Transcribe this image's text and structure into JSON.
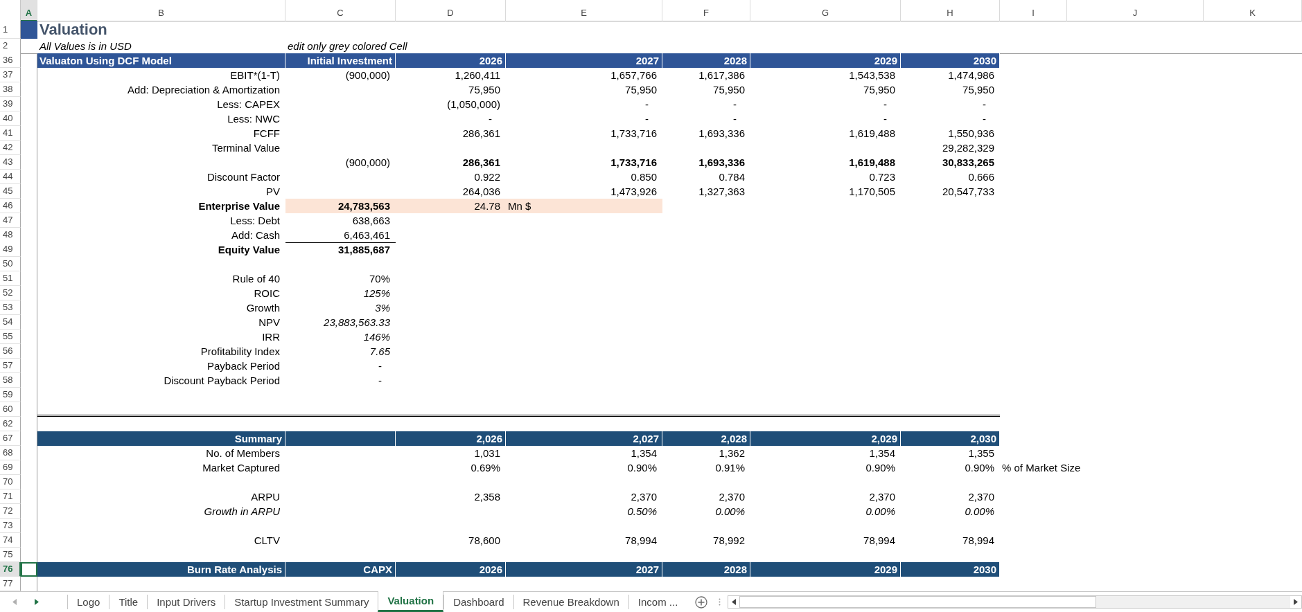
{
  "columns": [
    {
      "label": "A",
      "selected": true
    },
    {
      "label": "B",
      "selected": false
    },
    {
      "label": "C",
      "selected": false
    },
    {
      "label": "D",
      "selected": false
    },
    {
      "label": "E",
      "selected": false
    },
    {
      "label": "F",
      "selected": false
    },
    {
      "label": "G",
      "selected": false
    },
    {
      "label": "H",
      "selected": false
    },
    {
      "label": "I",
      "selected": false
    },
    {
      "label": "J",
      "selected": false
    },
    {
      "label": "K",
      "selected": false
    }
  ],
  "rows": [
    {
      "number": "1",
      "kind": "title",
      "selected": false,
      "cells": [
        {
          "kind": "fill"
        },
        {
          "kind": "title",
          "text": "Valuation"
        }
      ]
    },
    {
      "number": "2",
      "kind": "data",
      "selected": false,
      "cells": [
        {
          "kind": "empty"
        },
        {
          "kind": "note",
          "text": "All Values is in USD"
        },
        {
          "kind": "note",
          "text": "edit only grey colored Cell"
        }
      ]
    },
    {
      "number": "36",
      "kind": "band",
      "color": "#2f5597",
      "selected": false,
      "cells": [
        {
          "kind": "empty"
        },
        {
          "kind": "band-left",
          "text": "Valuaton Using DCF Model"
        },
        {
          "kind": "bold",
          "text": "Initial Investment"
        },
        {
          "kind": "bold",
          "text": "2026"
        },
        {
          "kind": "bold",
          "text": "2027"
        },
        {
          "kind": "bold",
          "text": "2028"
        },
        {
          "kind": "bold",
          "text": "2029"
        },
        {
          "kind": "bold",
          "text": "2030"
        }
      ]
    },
    {
      "number": "37",
      "kind": "data",
      "selected": false,
      "cells": [
        {
          "kind": "empty"
        },
        {
          "kind": "plain",
          "text": "EBIT*(1-T)"
        },
        {
          "kind": "plain",
          "text": "(900,000)"
        },
        {
          "kind": "plain",
          "text": "1,260,411"
        },
        {
          "kind": "plain",
          "text": "1,657,766"
        },
        {
          "kind": "plain",
          "text": "1,617,386"
        },
        {
          "kind": "plain",
          "text": "1,543,538"
        },
        {
          "kind": "plain",
          "text": "1,474,986"
        }
      ]
    },
    {
      "number": "38",
      "kind": "data",
      "selected": false,
      "cells": [
        {
          "kind": "empty"
        },
        {
          "kind": "plain",
          "text": "Add: Depreciation & Amortization"
        },
        {
          "kind": "empty"
        },
        {
          "kind": "plain",
          "text": "75,950"
        },
        {
          "kind": "plain",
          "text": "75,950"
        },
        {
          "kind": "plain",
          "text": "75,950"
        },
        {
          "kind": "plain",
          "text": "75,950"
        },
        {
          "kind": "plain",
          "text": "75,950"
        }
      ]
    },
    {
      "number": "39",
      "kind": "data",
      "selected": false,
      "cells": [
        {
          "kind": "empty"
        },
        {
          "kind": "plain",
          "text": "Less: CAPEX"
        },
        {
          "kind": "empty"
        },
        {
          "kind": "plain",
          "text": "(1,050,000)"
        },
        {
          "kind": "dash",
          "text": "-"
        },
        {
          "kind": "dash",
          "text": "-"
        },
        {
          "kind": "dash",
          "text": "-"
        },
        {
          "kind": "dash",
          "text": "-"
        }
      ]
    },
    {
      "number": "40",
      "kind": "data",
      "selected": false,
      "cells": [
        {
          "kind": "empty"
        },
        {
          "kind": "plain",
          "text": "Less: NWC"
        },
        {
          "kind": "empty"
        },
        {
          "kind": "dash",
          "text": "-"
        },
        {
          "kind": "dash",
          "text": "-"
        },
        {
          "kind": "dash",
          "text": "-"
        },
        {
          "kind": "dash",
          "text": "-"
        },
        {
          "kind": "dash",
          "text": "-"
        }
      ]
    },
    {
      "number": "41",
      "kind": "data",
      "selected": false,
      "cells": [
        {
          "kind": "empty"
        },
        {
          "kind": "plain",
          "text": "FCFF"
        },
        {
          "kind": "empty"
        },
        {
          "kind": "plain",
          "text": "286,361"
        },
        {
          "kind": "plain",
          "text": "1,733,716"
        },
        {
          "kind": "plain",
          "text": "1,693,336"
        },
        {
          "kind": "plain",
          "text": "1,619,488"
        },
        {
          "kind": "plain",
          "text": "1,550,936"
        }
      ]
    },
    {
      "number": "42",
      "kind": "data",
      "selected": false,
      "cells": [
        {
          "kind": "empty"
        },
        {
          "kind": "plain",
          "text": "Terminal Value"
        },
        {
          "kind": "empty"
        },
        {
          "kind": "empty"
        },
        {
          "kind": "empty"
        },
        {
          "kind": "empty"
        },
        {
          "kind": "empty"
        },
        {
          "kind": "plain",
          "text": "29,282,329"
        }
      ]
    },
    {
      "number": "43",
      "kind": "data",
      "selected": false,
      "cells": [
        {
          "kind": "empty"
        },
        {
          "kind": "empty"
        },
        {
          "kind": "plain",
          "text": "(900,000)"
        },
        {
          "kind": "bold",
          "text": "286,361"
        },
        {
          "kind": "bold",
          "text": "1,733,716"
        },
        {
          "kind": "bold",
          "text": "1,693,336"
        },
        {
          "kind": "bold",
          "text": "1,619,488"
        },
        {
          "kind": "bold",
          "text": "30,833,265"
        }
      ]
    },
    {
      "number": "44",
      "kind": "data",
      "selected": false,
      "cells": [
        {
          "kind": "empty"
        },
        {
          "kind": "plain",
          "text": "Discount Factor"
        },
        {
          "kind": "empty"
        },
        {
          "kind": "plain",
          "text": "0.922"
        },
        {
          "kind": "plain",
          "text": "0.850"
        },
        {
          "kind": "plain",
          "text": "0.784"
        },
        {
          "kind": "plain",
          "text": "0.723"
        },
        {
          "kind": "plain",
          "text": "0.666"
        }
      ]
    },
    {
      "number": "45",
      "kind": "data",
      "selected": false,
      "cells": [
        {
          "kind": "empty"
        },
        {
          "kind": "plain",
          "text": "PV"
        },
        {
          "kind": "empty"
        },
        {
          "kind": "plain",
          "text": "264,036"
        },
        {
          "kind": "plain",
          "text": "1,473,926"
        },
        {
          "kind": "plain",
          "text": "1,327,363"
        },
        {
          "kind": "plain",
          "text": "1,170,505"
        },
        {
          "kind": "plain",
          "text": "20,547,733"
        }
      ]
    },
    {
      "number": "46",
      "kind": "data",
      "selected": false,
      "cells": [
        {
          "kind": "empty"
        },
        {
          "kind": "bold",
          "text": "Enterprise Value"
        },
        {
          "kind": "shaded-bold",
          "text": "24,783,563"
        },
        {
          "kind": "shaded",
          "text": "24.78"
        },
        {
          "kind": "shaded-unit",
          "text": "Mn $"
        }
      ]
    },
    {
      "number": "47",
      "kind": "data",
      "selected": false,
      "cells": [
        {
          "kind": "empty"
        },
        {
          "kind": "plain",
          "text": "Less: Debt"
        },
        {
          "kind": "plain",
          "text": "638,663"
        }
      ]
    },
    {
      "number": "48",
      "kind": "data",
      "selected": false,
      "cells": [
        {
          "kind": "empty"
        },
        {
          "kind": "plain",
          "text": "Add: Cash"
        },
        {
          "kind": "ruled",
          "text": "6,463,461"
        }
      ]
    },
    {
      "number": "49",
      "kind": "data",
      "selected": false,
      "cells": [
        {
          "kind": "empty"
        },
        {
          "kind": "bold",
          "text": "Equity Value"
        },
        {
          "kind": "bold",
          "text": "31,885,687"
        }
      ]
    },
    {
      "number": "50",
      "kind": "data",
      "selected": false,
      "cells": []
    },
    {
      "number": "51",
      "kind": "data",
      "selected": false,
      "cells": [
        {
          "kind": "empty"
        },
        {
          "kind": "plain",
          "text": "Rule of 40"
        },
        {
          "kind": "plain",
          "text": "70%"
        }
      ]
    },
    {
      "number": "52",
      "kind": "data",
      "selected": false,
      "cells": [
        {
          "kind": "empty"
        },
        {
          "kind": "plain",
          "text": "ROIC"
        },
        {
          "kind": "italic",
          "text": "125%"
        }
      ]
    },
    {
      "number": "53",
      "kind": "data",
      "selected": false,
      "cells": [
        {
          "kind": "empty"
        },
        {
          "kind": "plain",
          "text": "Growth"
        },
        {
          "kind": "italic",
          "text": "3%"
        }
      ]
    },
    {
      "number": "54",
      "kind": "data",
      "selected": false,
      "cells": [
        {
          "kind": "empty"
        },
        {
          "kind": "plain",
          "text": "NPV"
        },
        {
          "kind": "italic",
          "text": "23,883,563.33"
        }
      ]
    },
    {
      "number": "55",
      "kind": "data",
      "selected": false,
      "cells": [
        {
          "kind": "empty"
        },
        {
          "kind": "plain",
          "text": "IRR"
        },
        {
          "kind": "italic",
          "text": "146%"
        }
      ]
    },
    {
      "number": "56",
      "kind": "data",
      "selected": false,
      "cells": [
        {
          "kind": "empty"
        },
        {
          "kind": "plain",
          "text": "Profitability Index"
        },
        {
          "kind": "italic",
          "text": "7.65"
        }
      ]
    },
    {
      "number": "57",
      "kind": "data",
      "selected": false,
      "cells": [
        {
          "kind": "empty"
        },
        {
          "kind": "plain",
          "text": "Payback Period"
        },
        {
          "kind": "dash",
          "text": "-"
        }
      ]
    },
    {
      "number": "58",
      "kind": "data",
      "selected": false,
      "cells": [
        {
          "kind": "empty"
        },
        {
          "kind": "plain",
          "text": "Discount Payback Period"
        },
        {
          "kind": "dash",
          "text": "-"
        }
      ]
    },
    {
      "number": "59",
      "kind": "data",
      "selected": false,
      "cells": []
    },
    {
      "number": "60",
      "kind": "rule",
      "selected": false,
      "cells": []
    },
    {
      "number": "62",
      "kind": "data",
      "selected": false,
      "cells": []
    },
    {
      "number": "67",
      "kind": "band",
      "color": "#1f4e78",
      "selected": false,
      "cells": [
        {
          "kind": "empty"
        },
        {
          "kind": "bold",
          "text": "Summary"
        },
        {
          "kind": "empty"
        },
        {
          "kind": "bold",
          "text": "2,026"
        },
        {
          "kind": "bold",
          "text": "2,027"
        },
        {
          "kind": "bold",
          "text": "2,028"
        },
        {
          "kind": "bold",
          "text": "2,029"
        },
        {
          "kind": "bold",
          "text": "2,030"
        }
      ]
    },
    {
      "number": "68",
      "kind": "data",
      "selected": false,
      "cells": [
        {
          "kind": "empty"
        },
        {
          "kind": "plain",
          "text": "No. of Members"
        },
        {
          "kind": "empty"
        },
        {
          "kind": "plain",
          "text": "1,031"
        },
        {
          "kind": "plain",
          "text": "1,354"
        },
        {
          "kind": "plain",
          "text": "1,362"
        },
        {
          "kind": "plain",
          "text": "1,354"
        },
        {
          "kind": "plain",
          "text": "1,355"
        }
      ]
    },
    {
      "number": "69",
      "kind": "data",
      "selected": false,
      "cells": [
        {
          "kind": "empty"
        },
        {
          "kind": "plain",
          "text": "Market Captured"
        },
        {
          "kind": "empty"
        },
        {
          "kind": "plain",
          "text": "0.69%"
        },
        {
          "kind": "plain",
          "text": "0.90%"
        },
        {
          "kind": "plain",
          "text": "0.91%"
        },
        {
          "kind": "plain",
          "text": "0.90%"
        },
        {
          "kind": "plain",
          "text": "0.90%"
        },
        {
          "kind": "unit",
          "text": "% of Market Size"
        }
      ]
    },
    {
      "number": "70",
      "kind": "data",
      "selected": false,
      "cells": []
    },
    {
      "number": "71",
      "kind": "data",
      "selected": false,
      "cells": [
        {
          "kind": "empty"
        },
        {
          "kind": "plain",
          "text": "ARPU"
        },
        {
          "kind": "empty"
        },
        {
          "kind": "plain",
          "text": "2,358"
        },
        {
          "kind": "plain",
          "text": "2,370"
        },
        {
          "kind": "plain",
          "text": "2,370"
        },
        {
          "kind": "plain",
          "text": "2,370"
        },
        {
          "kind": "plain",
          "text": "2,370"
        }
      ]
    },
    {
      "number": "72",
      "kind": "data",
      "selected": false,
      "cells": [
        {
          "kind": "empty"
        },
        {
          "kind": "italic",
          "text": "Growth in ARPU"
        },
        {
          "kind": "empty"
        },
        {
          "kind": "empty"
        },
        {
          "kind": "italic",
          "text": "0.50%"
        },
        {
          "kind": "italic",
          "text": "0.00%"
        },
        {
          "kind": "italic",
          "text": "0.00%"
        },
        {
          "kind": "italic",
          "text": "0.00%"
        }
      ]
    },
    {
      "number": "73",
      "kind": "data",
      "selected": false,
      "cells": []
    },
    {
      "number": "74",
      "kind": "data",
      "selected": false,
      "cells": [
        {
          "kind": "empty"
        },
        {
          "kind": "plain",
          "text": "CLTV"
        },
        {
          "kind": "empty"
        },
        {
          "kind": "plain",
          "text": "78,600"
        },
        {
          "kind": "plain",
          "text": "78,994"
        },
        {
          "kind": "plain",
          "text": "78,992"
        },
        {
          "kind": "plain",
          "text": "78,994"
        },
        {
          "kind": "plain",
          "text": "78,994"
        }
      ]
    },
    {
      "number": "75",
      "kind": "data",
      "selected": false,
      "cells": []
    },
    {
      "number": "76",
      "kind": "band",
      "color": "#1f4e78",
      "selected": true,
      "cells": [
        {
          "kind": "active"
        },
        {
          "kind": "bold",
          "text": "Burn Rate Analysis"
        },
        {
          "kind": "bold",
          "text": "CAPX"
        },
        {
          "kind": "bold",
          "text": "2026"
        },
        {
          "kind": "bold",
          "text": "2027"
        },
        {
          "kind": "bold",
          "text": "2028"
        },
        {
          "kind": "bold",
          "text": "2029"
        },
        {
          "kind": "bold",
          "text": "2030"
        }
      ]
    },
    {
      "number": "77",
      "kind": "data",
      "selected": false,
      "cells": []
    }
  ],
  "sheet_tabs": [
    {
      "label": "Logo",
      "selected": false
    },
    {
      "label": "Title",
      "selected": false
    },
    {
      "label": "Input Drivers",
      "selected": false
    },
    {
      "label": "Startup Investment Summary",
      "selected": false
    },
    {
      "label": "Valuation",
      "selected": true
    },
    {
      "label": "Dashboard",
      "selected": false
    },
    {
      "label": "Revenue Breakdown",
      "selected": false
    },
    {
      "label": "Incom ...",
      "selected": false
    }
  ]
}
